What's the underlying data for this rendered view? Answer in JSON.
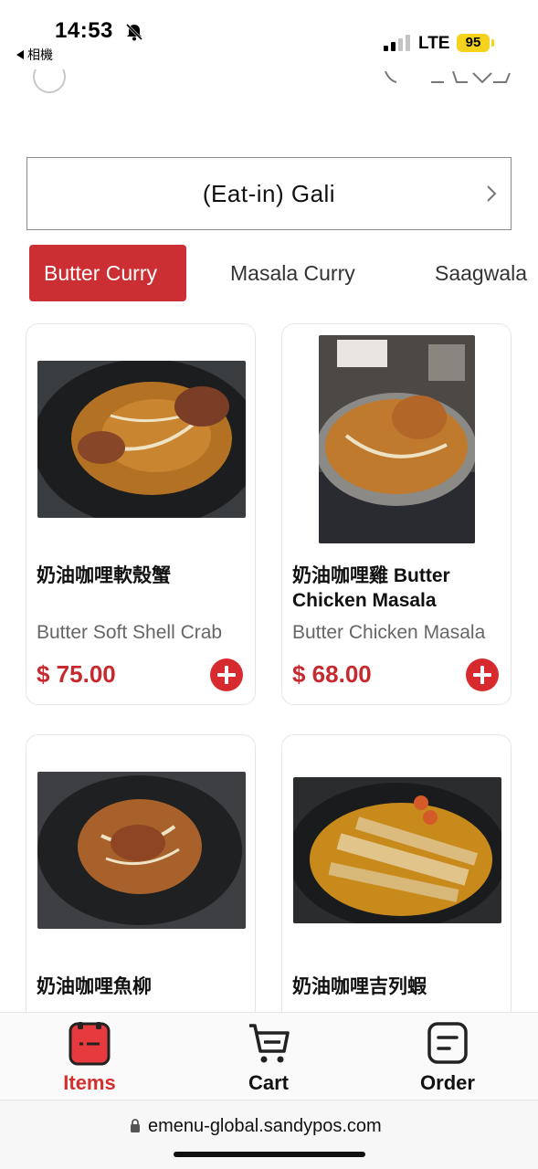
{
  "status_bar": {
    "time": "14:53",
    "back_label": "相機",
    "network": "LTE",
    "battery": "95",
    "icons": [
      "bell-muted-icon",
      "signal-icon",
      "battery-icon"
    ]
  },
  "store_selector": {
    "label": "(Eat-in) Gali",
    "icon": "chevron-right-icon"
  },
  "categories": [
    {
      "label": "Butter Curry",
      "active": true
    },
    {
      "label": "Masala Curry",
      "active": false
    },
    {
      "label": "Saagwala",
      "active": false
    }
  ],
  "products": [
    {
      "name": "奶油咖哩軟殼蟹",
      "subtitle": "Butter Soft Shell Crab",
      "price": "$ 75.00",
      "add_icon": "plus-circle-icon"
    },
    {
      "name": "奶油咖哩雞 Butter Chicken Masala",
      "subtitle": "Butter Chicken Masala",
      "price": "$ 68.00",
      "add_icon": "plus-circle-icon"
    },
    {
      "name": "奶油咖哩魚柳",
      "subtitle": "",
      "price": "",
      "add_icon": ""
    },
    {
      "name": "奶油咖哩吉列蝦",
      "subtitle": "",
      "price": "",
      "add_icon": ""
    }
  ],
  "bottom_nav": [
    {
      "label": "Items",
      "icon": "items-icon",
      "active": true
    },
    {
      "label": "Cart",
      "icon": "cart-icon",
      "active": false
    },
    {
      "label": "Order",
      "icon": "order-icon",
      "active": false
    }
  ],
  "browser": {
    "url": "emenu-global.sandypos.com",
    "icon": "lock-icon"
  },
  "colors": {
    "accent": "#cc2f33",
    "price": "#c62a2e",
    "add_button": "#d72a2f",
    "battery": "#f5d21c"
  }
}
